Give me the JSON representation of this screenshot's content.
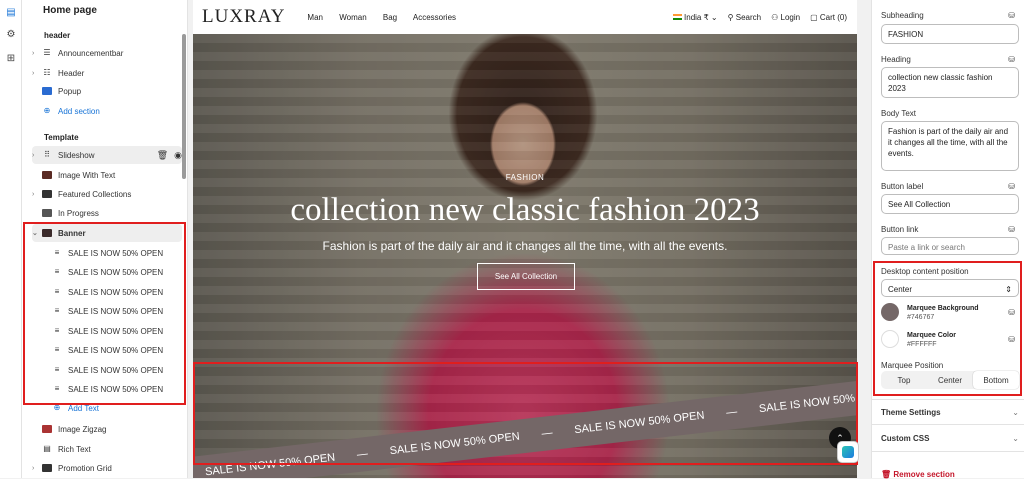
{
  "rail": {
    "icons": [
      "layout-icon",
      "gear-icon",
      "apps-icon"
    ]
  },
  "tree": {
    "page_title": "Home page",
    "header_label": "header",
    "header_items": [
      {
        "label": "Announcementbar",
        "icon": "list-icon"
      },
      {
        "label": "Header",
        "icon": "header-icon"
      },
      {
        "label": "Popup",
        "icon": "popup-icon"
      }
    ],
    "add_section": "Add section",
    "template_label": "Template",
    "template_items": [
      {
        "label": "Slideshow"
      },
      {
        "label": "Image With Text"
      },
      {
        "label": "Featured Collections"
      },
      {
        "label": "In Progress"
      },
      {
        "label": "Banner"
      }
    ],
    "banner_children": [
      "SALE IS NOW 50% OPEN",
      "SALE IS NOW 50% OPEN",
      "SALE IS NOW 50% OPEN",
      "SALE IS NOW 50% OPEN",
      "SALE IS NOW 50% OPEN",
      "SALE IS NOW 50% OPEN",
      "SALE IS NOW 50% OPEN",
      "SALE IS NOW 50% OPEN"
    ],
    "add_text": "Add Text",
    "after_items": [
      {
        "label": "Image Zigzag"
      },
      {
        "label": "Rich Text"
      },
      {
        "label": "Promotion Grid"
      }
    ]
  },
  "store": {
    "logo": "LUXRAY",
    "nav": [
      "Man",
      "Woman",
      "Bag",
      "Accessories"
    ],
    "locale": "India ₹",
    "search": "Search",
    "login": "Login",
    "cart": "Cart (0)"
  },
  "hero": {
    "subheading": "FASHION",
    "heading": "collection new classic fashion 2023",
    "body": "Fashion is part of the daily air and it changes all the time, with all the events.",
    "button": "See All Collection",
    "marquee": [
      "SALE IS NOW 50% OPEN",
      "—",
      "SALE IS NOW 50% OPEN",
      "—",
      "SALE IS NOW 50% OPEN",
      "—",
      "SALE IS NOW 50%"
    ]
  },
  "settings": {
    "subheading_label": "Subheading",
    "subheading_value": "FASHION",
    "heading_label": "Heading",
    "heading_value": "collection new classic fashion 2023",
    "body_label": "Body Text",
    "body_value": "Fashion is part of the daily air and it changes all the time, with all the events.",
    "button_label_label": "Button label",
    "button_label_value": "See All Collection",
    "button_link_label": "Button link",
    "button_link_placeholder": "Paste a link or search",
    "desktop_pos_label": "Desktop content position",
    "desktop_pos_value": "Center",
    "marquee_bg_label": "Marquee Background",
    "marquee_bg_value": "#746767",
    "marquee_color_label": "Marquee Color",
    "marquee_color_value": "#FFFFFF",
    "marquee_pos_label": "Marquee Position",
    "marquee_pos_options": [
      "Top",
      "Center",
      "Bottom"
    ],
    "marquee_pos_selected": "Bottom",
    "theme_settings": "Theme Settings",
    "custom_css": "Custom CSS",
    "remove_section": "Remove section"
  },
  "colors": {
    "marquee_bg": "#746767",
    "marquee_text": "#FFFFFF",
    "highlight": "#E01E1E",
    "link": "#1773D6"
  }
}
